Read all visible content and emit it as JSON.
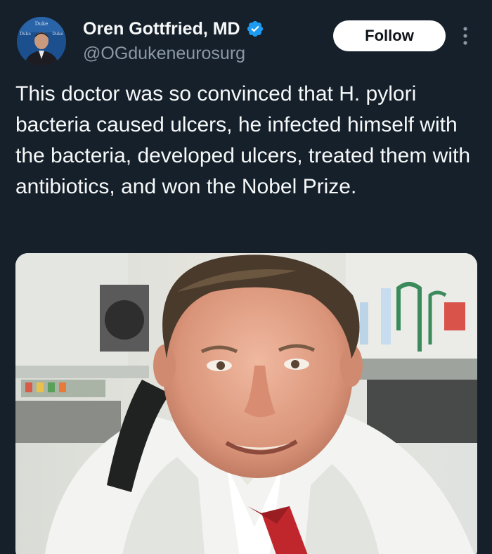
{
  "author": {
    "display_name": "Oren Gottfried, MD",
    "handle": "@OGdukeneurosurg",
    "verified": true,
    "verified_color": "#1d9bf0",
    "avatar_icon": "profile-photo-avatar"
  },
  "actions": {
    "follow_label": "Follow",
    "more_icon": "more-vertical-icon"
  },
  "tweet": {
    "text": "This doctor was so convinced that H. pylori bacteria caused ulcers, he infected himself with the bacteria, developed ulcers, treated them with antibiotics, and won the Nobel Prize."
  },
  "media": {
    "type": "photo",
    "description_icon": "photo-doctor-in-lab"
  },
  "colors": {
    "background": "#15202b",
    "text_primary": "#f7f9f9",
    "text_secondary": "#8b98a5",
    "follow_bg": "#ffffff"
  }
}
